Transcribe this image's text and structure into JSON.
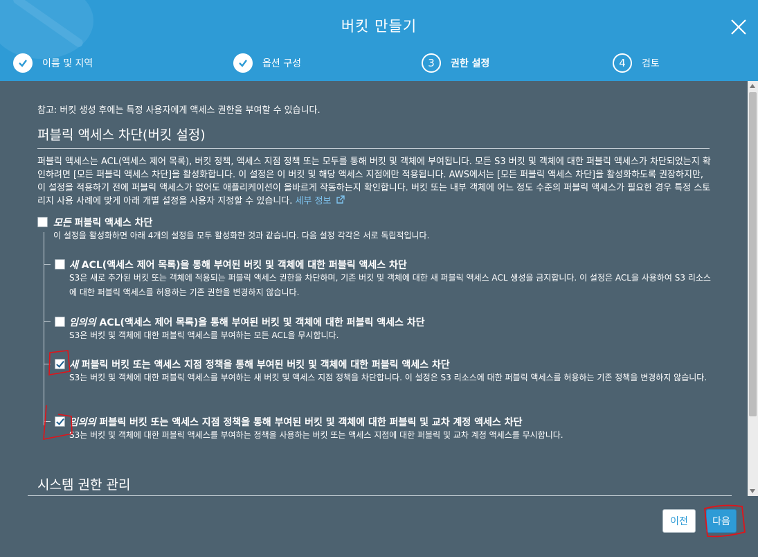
{
  "dialog": {
    "title": "버킷 만들기",
    "close_icon": "close-icon"
  },
  "steps": [
    {
      "label": "이름 및 지역",
      "state": "done"
    },
    {
      "label": "옵션 구성",
      "state": "done"
    },
    {
      "number": "3",
      "label": "권한 설정",
      "state": "active"
    },
    {
      "number": "4",
      "label": "검토",
      "state": "pending"
    }
  ],
  "content": {
    "note": "참고: 버킷 생성 후에는 특정 사용자에게 액세스 권한을 부여할 수 있습니다.",
    "section_title": "퍼블릭 액세스 차단(버킷 설정)",
    "description": "퍼블릭 액세스는 ACL(액세스 제어 목록), 버킷 정책, 액세스 지점 정책 또는 모두를 통해 버킷 및 객체에 부여됩니다. 모든 S3 버킷 및 객체에 대한 퍼블릭 액세스가 차단되었는지 확인하려면 [모든 퍼블릭 액세스 차단]을 활성화합니다. 이 설정은 이 버킷 및 해당 액세스 지점에만 적용됩니다. AWS에서는 [모든 퍼블릭 액세스 차단]을 활성화하도록 권장하지만, 이 설정을 적용하기 전에 퍼블릭 액세스가 없어도 애플리케이션이 올바르게 작동하는지 확인합니다. 버킷 또는 내부 객체에 어느 정도 수준의 퍼블릭 액세스가 필요한 경우 특정 스토리지 사용 사례에 맞게 아래 개별 설정을 사용자 지정할 수 있습니다.",
    "details_link": "세부 정보",
    "block_all": {
      "title_em": "모든",
      "title_rest": " 퍼블릭 액세스 차단",
      "desc": "이 설정을 활성화하면 아래 4개의 설정을 모두 활성화한 것과 같습니다. 다음 설정 각각은 서로 독립적입니다.",
      "checked": false
    },
    "options": [
      {
        "title_em": "새",
        "title_rest": " ACL(액세스 제어 목록)을 통해 부여된 버킷 및 객체에 대한 퍼블릭 액세스 차단",
        "desc": "S3은 새로 추가된 버킷 또는 객체에 적용되는 퍼블릭 액세스 권한을 차단하며, 기존 버킷 및 객체에 대한 새 퍼블릭 액세스 ACL 생성을 금지합니다. 이 설정은 ACL을 사용하여 S3 리소스에 대한 퍼블릭 액세스를 허용하는 기존 권한을 변경하지 않습니다.",
        "checked": false
      },
      {
        "title_em": "임의의",
        "title_rest": " ACL(액세스 제어 목록)을 통해 부여된 버킷 및 객체에 대한 퍼블릭 액세스 차단",
        "desc": "S3은 버킷 및 객체에 대한 퍼블릭 액세스를 부여하는 모든 ACL을 무시합니다.",
        "checked": false
      },
      {
        "title_em": "새",
        "title_rest": " 퍼블릭 버킷 또는 액세스 지점 정책을 통해 부여된 버킷 및 객체에 대한 퍼블릭 액세스 차단",
        "desc": "S3는 버킷 및 객체에 대한 퍼블릭 액세스를 부여하는 새 버킷 및 액세스 지점 정책을 차단합니다. 이 설정은 S3 리소스에 대한 퍼블릭 액세스를 허용하는 기존 정책을 변경하지 않습니다.",
        "checked": true
      },
      {
        "title_em": "임의의",
        "title_rest": " 퍼블릭 버킷 또는 액세스 지점 정책을 통해 부여된 버킷 및 객체에 대한 퍼블릭 및 교차 계정 액세스 차단",
        "desc": "S3는 버킷 및 객체에 대한 퍼블릭 액세스를 부여하는 정책을 사용하는 버킷 또는 액세스 지점에 대한 퍼블릭 및 교차 계정 액세스를 무시합니다.",
        "checked": true
      }
    ],
    "section2_title": "시스템 권한 관리"
  },
  "footer": {
    "prev_label": "이전",
    "next_label": "다음"
  },
  "colors": {
    "header": "#2e9bd6",
    "content": "#4d6270",
    "annotation": "#e0141a"
  }
}
